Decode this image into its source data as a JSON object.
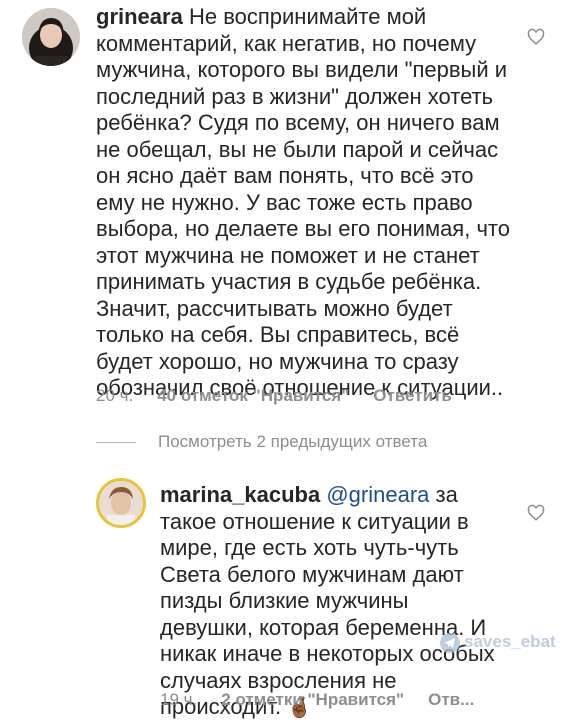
{
  "comment1": {
    "username": "grineara",
    "text": "Не воспринимайте мой комментарий, как негатив, но почему мужчина, которого вы видели \"первый и последний раз в жизни\" должен хотеть ребёнка? Судя по всему, он ничего вам не обещал, вы не были парой и сейчас он ясно даёт вам понять, что всё это ему не нужно. У вас тоже есть право выбора, но делаете вы его понимая, что этот мужчина не поможет и не станет принимать участия в судьбе ребёнка. Значит, рассчитывать можно будет только на себя. Вы справитесь, всё будет хорошо, но мужчина то сразу обозначил своё отношение к ситуации..",
    "time": "20 ч.",
    "likes": "40 отметок \"Нравится\"",
    "reply": "Ответить"
  },
  "view_replies": "Посмотреть 2 предыдущих ответа",
  "comment2": {
    "username": "marina_kacuba",
    "mention": "@grineara",
    "text": "за такое отношение к ситуации в мире, где есть хоть чуть-чуть Света белого мужчинам дают пизды близкие мужчины девушки, которая беременна. И никак иначе в некоторых особых случаях взросления не происходит.",
    "emoji": "🤞🏾",
    "time": "19 ч.",
    "likes": "2 отметки \"Нравится\"",
    "reply": "Отв..."
  },
  "watermark": "saves_ebat",
  "icons": {
    "like": "heart-outline-icon",
    "watermark": "telegram-icon"
  },
  "colors": {
    "text": "#262626",
    "meta": "#8e8e8e",
    "mention": "#1c4e91",
    "story_ring": "#e7c43a"
  }
}
